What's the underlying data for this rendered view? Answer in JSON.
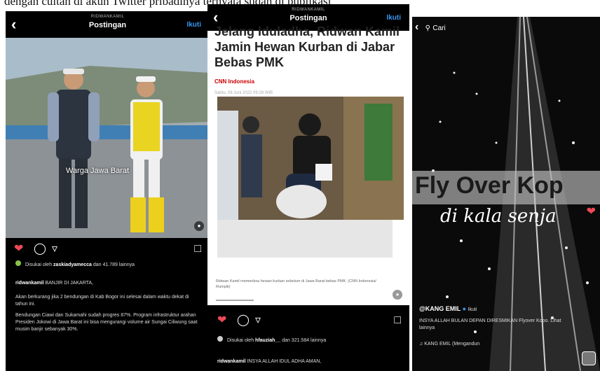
{
  "page": {
    "top_text": "dengan cuitan di akun Twitter pribadinya ternyata sudah di publikasi"
  },
  "post1": {
    "header": {
      "username": "RIDWANKAMIL",
      "title": "Postingan",
      "follow": "Ikuti"
    },
    "photo_caption": "Warga Jawa Barat",
    "liked_by_prefix": "Disukai oleh",
    "liked_by_user": "zaskiadyamecca",
    "liked_by_suffix": "dan 41.789 lainnya",
    "caption_user": "ridwankamil",
    "caption_text": "BANJIR DI JAKARTA,",
    "caption_p2": "Akan berkurang jika 2 bendungan di Kab Bogor ini selesai dalam waktu dekat di tahun ini.",
    "caption_p3": "Bendungan Ciawi dan Sukamahi sudah progres 87%. Program infrastruktur arahan Presiden Jokowi di Jawa Barat ini bisa mengurangi volume air Sungai Ciliwung saat musim banjir sebanyak 30%."
  },
  "post2": {
    "header": {
      "username": "RIDWANKAMIL",
      "title": "Postingan",
      "follow": "Ikuti"
    },
    "headline": "Jelang Iduladha, Ridwan Kamil Jamin Hewan Kurban di Jabar Bebas PMK",
    "source": "CNN Indonesia",
    "date": "Sabtu, 08 Juni 2022 09:28 WIB",
    "image_caption": "Ridwan Kamil memeriksa hewan kurban sebelum di Jawa Barat bebas PMK. (CNN Indonesia/ Rumpik)",
    "liked_by_prefix": "Disukai oleh",
    "liked_by_user": "hfauziah__",
    "liked_by_suffix": "dan 321.584 lainnya",
    "caption_user": "ridwankamil",
    "caption_text": "INSYA ALLAH IDUL ADHA AMAN,"
  },
  "post3": {
    "search": "Cari",
    "overlay_title": "Fly Over Kop",
    "overlay_script": "di kala senja",
    "user": "@KANG EMIL",
    "follow": "Ikuti",
    "caption": "INSYA ALLAH BULAN DEPAN DIRESMIKAN Flyover Kopo. Lihat lainnya",
    "music": "KANG EMIL (Mengandun"
  },
  "colors": {
    "like_red": "#ed4956",
    "link_blue": "#3897f0",
    "cnn_red": "#cc0000"
  },
  "icons": [
    "back-chevron-icon",
    "heart-icon",
    "comment-icon",
    "share-icon",
    "bookmark-icon",
    "music-icon",
    "verified-badge-icon",
    "search-icon"
  ]
}
